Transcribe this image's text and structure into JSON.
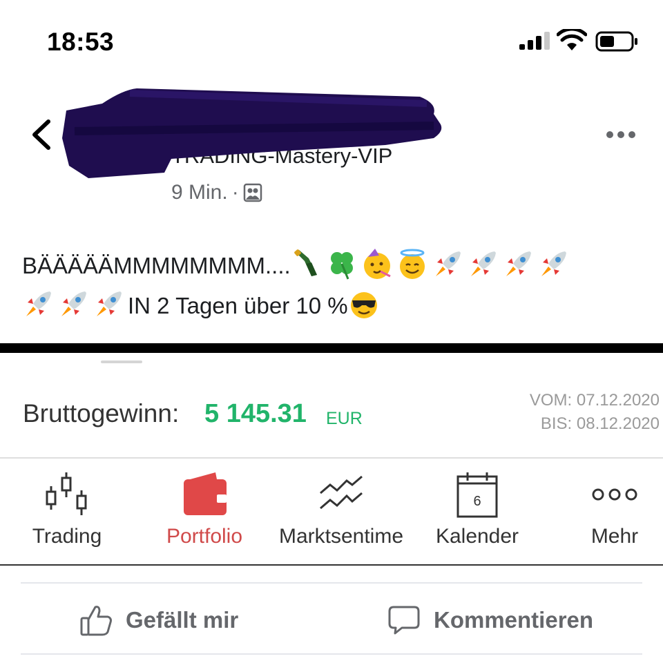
{
  "status_bar": {
    "time": "18:53"
  },
  "post": {
    "group_name": "TRADING-Mastery-VIP",
    "time_ago": "9 Min.",
    "meta_separator": "·",
    "text_line1": "BÄÄÄÄÄMMMMMMMM....",
    "text_line2": "IN 2 Tagen über 10 %"
  },
  "screenshot_app": {
    "profit_label": "Bruttogewinn:",
    "profit_value": "5 145.31",
    "profit_currency": "EUR",
    "date_from_label": "VOM:",
    "date_from": "07.12.2020",
    "date_to_label": "BIS:",
    "date_to": "08.12.2020",
    "tabs": [
      {
        "label": "Trading",
        "icon": "candlestick-icon"
      },
      {
        "label": "Portfolio",
        "icon": "wallet-icon"
      },
      {
        "label": "Marktsentime",
        "icon": "trend-lines-icon"
      },
      {
        "label": "Kalender",
        "icon": "calendar-icon",
        "badge": "6"
      },
      {
        "label": "Mehr",
        "icon": "three-circles-icon"
      }
    ]
  },
  "actions": {
    "like": "Gefällt mir",
    "comment": "Kommentieren"
  },
  "colors": {
    "profit_green": "#21b46a",
    "portfolio_red": "#e04848",
    "redaction": "#1f0d4f",
    "meta_gray": "#65676b"
  }
}
